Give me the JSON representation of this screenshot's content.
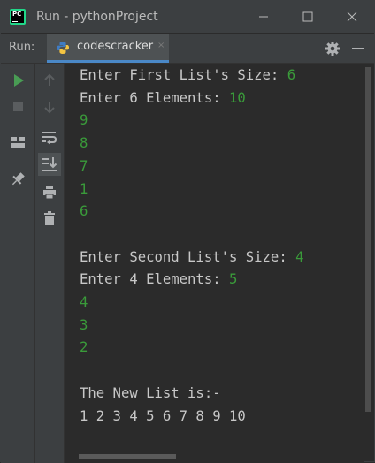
{
  "window": {
    "title": "Run - pythonProject",
    "logo_text": "PC",
    "controls": [
      "minimize-icon",
      "maximize-icon",
      "close-icon"
    ]
  },
  "toolbar": {
    "run_label": "Run:",
    "tab_label": "codescracker",
    "tab_icon": "python-icon",
    "tab_close": "×",
    "right_icons": [
      "settings-icon",
      "hide-panel-icon"
    ],
    "accent_color": "#4a88c7"
  },
  "gutter": {
    "primary": [
      "rerun-icon",
      "stop-icon",
      "layout-icon",
      "pin-icon"
    ],
    "secondary": [
      "up-arrow-icon",
      "down-arrow-icon",
      "soft-wrap-icon",
      "scroll-to-end-icon",
      "print-icon",
      "trash-icon"
    ],
    "run_color": "#499c54"
  },
  "console": {
    "lines": [
      {
        "prompt": "Enter First List's Size: ",
        "input": "6"
      },
      {
        "prompt": "Enter 6 Elements: ",
        "input": "10"
      },
      {
        "prompt": "",
        "input": "9"
      },
      {
        "prompt": "",
        "input": "8"
      },
      {
        "prompt": "",
        "input": "7"
      },
      {
        "prompt": "",
        "input": "1"
      },
      {
        "prompt": "",
        "input": "6"
      },
      {
        "prompt": "",
        "input": ""
      },
      {
        "prompt": "Enter Second List's Size: ",
        "input": "4"
      },
      {
        "prompt": "Enter 4 Elements: ",
        "input": "5"
      },
      {
        "prompt": "",
        "input": "4"
      },
      {
        "prompt": "",
        "input": "3"
      },
      {
        "prompt": "",
        "input": "2"
      },
      {
        "prompt": "",
        "input": ""
      },
      {
        "prompt": "The New List is:-",
        "input": ""
      },
      {
        "prompt": "1 2 3 4 5 6 7 8 9 10",
        "input": ""
      }
    ],
    "input_color": "#3a9b3a",
    "text_color": "#c8c8c8"
  }
}
